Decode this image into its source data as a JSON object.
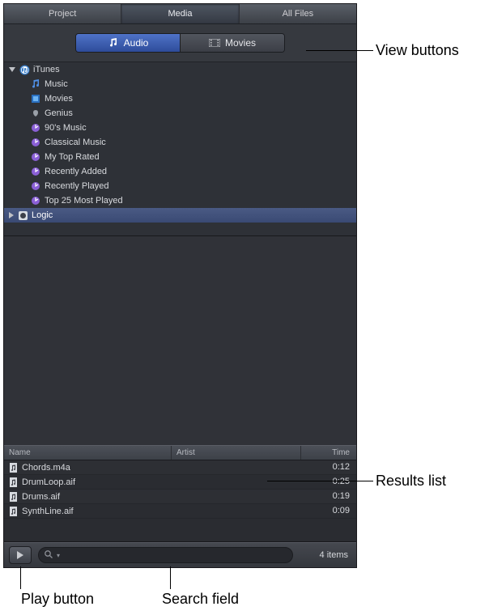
{
  "tabs": [
    "Project",
    "Media",
    "All Files"
  ],
  "active_tab_index": 1,
  "view_buttons": {
    "audio": "Audio",
    "movies": "Movies",
    "active": "audio"
  },
  "sidebar": {
    "roots": [
      {
        "label": "iTunes",
        "expanded": true,
        "icon": "itunes-icon",
        "children": [
          {
            "label": "Music",
            "icon": "music-icon"
          },
          {
            "label": "Movies",
            "icon": "movies-icon"
          },
          {
            "label": "Genius",
            "icon": "genius-icon"
          },
          {
            "label": "90's Music",
            "icon": "smartlist-icon"
          },
          {
            "label": "Classical Music",
            "icon": "smartlist-icon"
          },
          {
            "label": "My Top Rated",
            "icon": "smartlist-icon"
          },
          {
            "label": "Recently Added",
            "icon": "smartlist-icon"
          },
          {
            "label": "Recently Played",
            "icon": "smartlist-icon"
          },
          {
            "label": "Top 25 Most Played",
            "icon": "smartlist-icon"
          }
        ]
      },
      {
        "label": "Logic",
        "expanded": false,
        "icon": "logic-icon",
        "selected": true
      }
    ]
  },
  "results": {
    "columns": {
      "name": "Name",
      "artist": "Artist",
      "time": "Time"
    },
    "rows": [
      {
        "name": "Chords.m4a",
        "artist": "",
        "time": "0:12"
      },
      {
        "name": "DrumLoop.aif",
        "artist": "",
        "time": "0:25"
      },
      {
        "name": "Drums.aif",
        "artist": "",
        "time": "0:19"
      },
      {
        "name": "SynthLine.aif",
        "artist": "",
        "time": "0:09"
      }
    ]
  },
  "footer": {
    "search_placeholder": "",
    "item_count": "4 items"
  },
  "annotations": {
    "view_buttons": "View buttons",
    "results_list": "Results list",
    "play_button": "Play button",
    "search_field": "Search field"
  }
}
